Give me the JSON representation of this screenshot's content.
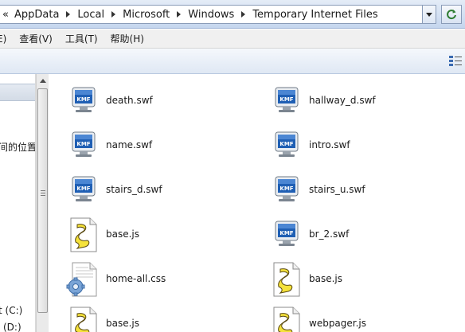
{
  "address_bar": {
    "overflow": "«",
    "crumbs": [
      "AppData",
      "Local",
      "Microsoft",
      "Windows",
      "Temporary Internet Files"
    ]
  },
  "menu": {
    "items": [
      "E)",
      "查看(V)",
      "工具(T)",
      "帮助(H)"
    ]
  },
  "nav_pane": {
    "items": [
      "间的位置",
      "t (C:)",
      "(D:)"
    ]
  },
  "files": [
    {
      "name": "death.swf",
      "icon": "swf-file-icon"
    },
    {
      "name": "hallway_d.swf",
      "icon": "swf-file-icon"
    },
    {
      "name": "name.swf",
      "icon": "swf-file-icon"
    },
    {
      "name": "intro.swf",
      "icon": "swf-file-icon"
    },
    {
      "name": "stairs_d.swf",
      "icon": "swf-file-icon"
    },
    {
      "name": "stairs_u.swf",
      "icon": "swf-file-icon"
    },
    {
      "name": "base.js",
      "icon": "script-file-icon"
    },
    {
      "name": "br_2.swf",
      "icon": "swf-file-icon"
    },
    {
      "name": "home-all.css",
      "icon": "css-file-icon"
    },
    {
      "name": "base.js",
      "icon": "script-file-icon"
    },
    {
      "name": "base.js",
      "icon": "script-file-icon"
    },
    {
      "name": "webpager.js",
      "icon": "script-file-icon"
    }
  ],
  "colors": {
    "swf_screen": "#1f5fb4",
    "script_yellow": "#f5e23a",
    "gear_blue": "#7aa4d6"
  }
}
